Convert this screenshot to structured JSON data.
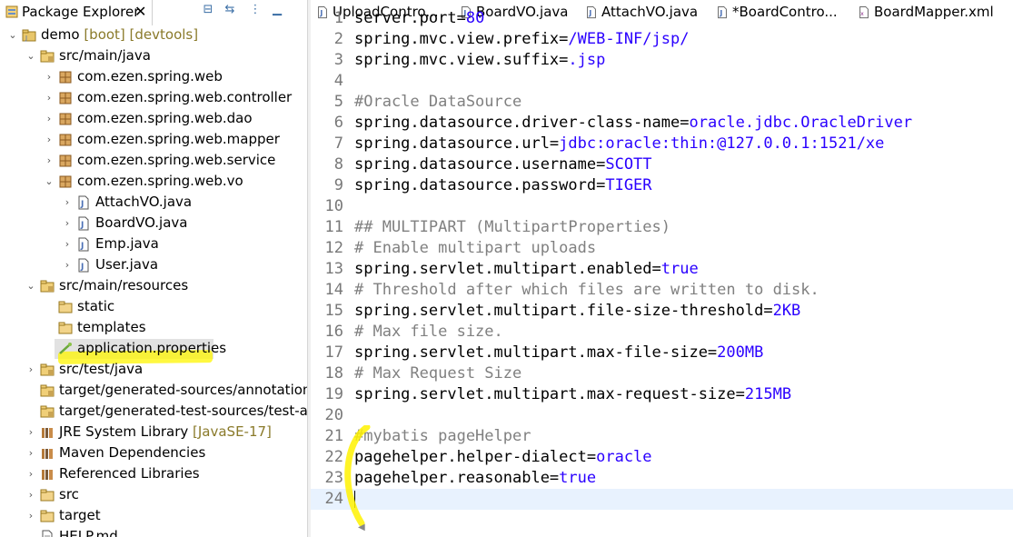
{
  "explorer": {
    "title": "Package Explorer",
    "close": "✕",
    "toolbar_icons": [
      "collapse-all-icon",
      "link-with-editor-icon",
      "view-menu-icon",
      "minimize-icon"
    ],
    "items": [
      {
        "label": "demo",
        "suffix": " [boot] [devtools]",
        "icon": "project-icon",
        "arrow": "⌄"
      },
      {
        "label": "src/main/java",
        "suffix": "",
        "icon": "source-folder-icon",
        "arrow": "⌄"
      },
      {
        "label": "com.ezen.spring.web",
        "suffix": "",
        "icon": "package-icon",
        "arrow": "›"
      },
      {
        "label": "com.ezen.spring.web.controller",
        "suffix": "",
        "icon": "package-icon",
        "arrow": "›"
      },
      {
        "label": "com.ezen.spring.web.dao",
        "suffix": "",
        "icon": "package-icon",
        "arrow": "›"
      },
      {
        "label": "com.ezen.spring.web.mapper",
        "suffix": "",
        "icon": "package-icon",
        "arrow": "›"
      },
      {
        "label": "com.ezen.spring.web.service",
        "suffix": "",
        "icon": "package-icon",
        "arrow": "›"
      },
      {
        "label": "com.ezen.spring.web.vo",
        "suffix": "",
        "icon": "package-icon",
        "arrow": "⌄"
      },
      {
        "label": "AttachVO.java",
        "suffix": "",
        "icon": "java-file-icon",
        "arrow": "›"
      },
      {
        "label": "BoardVO.java",
        "suffix": "",
        "icon": "java-file-icon",
        "arrow": "›"
      },
      {
        "label": "Emp.java",
        "suffix": "",
        "icon": "java-file-icon",
        "arrow": "›"
      },
      {
        "label": "User.java",
        "suffix": "",
        "icon": "java-file-icon",
        "arrow": "›"
      },
      {
        "label": "src/main/resources",
        "suffix": "",
        "icon": "source-folder-icon",
        "arrow": "⌄"
      },
      {
        "label": "static",
        "suffix": "",
        "icon": "folder-icon",
        "arrow": ""
      },
      {
        "label": "templates",
        "suffix": "",
        "icon": "folder-icon",
        "arrow": ""
      },
      {
        "label": "application.properties",
        "suffix": "",
        "icon": "properties-file-icon",
        "arrow": ""
      },
      {
        "label": "src/test/java",
        "suffix": "",
        "icon": "source-folder-icon",
        "arrow": "›"
      },
      {
        "label": "target/generated-sources/annotations",
        "suffix": "",
        "icon": "source-folder-icon",
        "arrow": ""
      },
      {
        "label": "target/generated-test-sources/test-annotations",
        "suffix": "",
        "icon": "source-folder-icon",
        "arrow": ""
      },
      {
        "label": "JRE System Library",
        "suffix": " [JavaSE-17]",
        "icon": "library-icon",
        "arrow": "›"
      },
      {
        "label": "Maven Dependencies",
        "suffix": "",
        "icon": "library-icon",
        "arrow": "›"
      },
      {
        "label": "Referenced Libraries",
        "suffix": "",
        "icon": "library-icon",
        "arrow": "›"
      },
      {
        "label": "src",
        "suffix": "",
        "icon": "folder-icon",
        "arrow": "›"
      },
      {
        "label": "target",
        "suffix": "",
        "icon": "folder-icon",
        "arrow": "›"
      },
      {
        "label": "HELP.md",
        "suffix": "",
        "icon": "text-file-icon",
        "arrow": ""
      }
    ]
  },
  "editor": {
    "tabs": [
      {
        "label": "UploadContro...",
        "icon": "java-file-icon"
      },
      {
        "label": "BoardVO.java",
        "icon": "java-file-icon"
      },
      {
        "label": "AttachVO.java",
        "icon": "java-file-icon"
      },
      {
        "label": "*BoardContro...",
        "icon": "java-file-icon"
      },
      {
        "label": "BoardMapper.xml",
        "icon": "xml-file-icon"
      }
    ],
    "lines": [
      {
        "n": "1",
        "key": "server.port=",
        "value": "80",
        "comment": ""
      },
      {
        "n": "2",
        "key": "spring.mvc.view.prefix=",
        "value": "/WEB-INF/jsp/",
        "comment": ""
      },
      {
        "n": "3",
        "key": "spring.mvc.view.suffix=",
        "value": ".jsp",
        "comment": ""
      },
      {
        "n": "4",
        "key": "",
        "value": "",
        "comment": ""
      },
      {
        "n": "5",
        "key": "",
        "value": "",
        "comment": "#Oracle DataSource"
      },
      {
        "n": "6",
        "key": "spring.datasource.driver-class-name=",
        "value": "oracle.jdbc.OracleDriver",
        "comment": ""
      },
      {
        "n": "7",
        "key": "spring.datasource.url=",
        "value": "jdbc:oracle:thin:@127.0.0.1:1521/xe",
        "comment": ""
      },
      {
        "n": "8",
        "key": "spring.datasource.username=",
        "value": "SCOTT",
        "comment": ""
      },
      {
        "n": "9",
        "key": "spring.datasource.password=",
        "value": "TIGER",
        "comment": ""
      },
      {
        "n": "10",
        "key": "",
        "value": "",
        "comment": ""
      },
      {
        "n": "11",
        "key": "",
        "value": "",
        "comment": "## MULTIPART (MultipartProperties)"
      },
      {
        "n": "12",
        "key": "",
        "value": "",
        "comment": "# Enable multipart uploads"
      },
      {
        "n": "13",
        "key": "spring.servlet.multipart.enabled=",
        "value": "true",
        "comment": ""
      },
      {
        "n": "14",
        "key": "",
        "value": "",
        "comment": "# Threshold after which files are written to disk."
      },
      {
        "n": "15",
        "key": "spring.servlet.multipart.file-size-threshold=",
        "value": "2KB",
        "comment": ""
      },
      {
        "n": "16",
        "key": "",
        "value": "",
        "comment": "# Max file size."
      },
      {
        "n": "17",
        "key": "spring.servlet.multipart.max-file-size=",
        "value": "200MB",
        "comment": ""
      },
      {
        "n": "18",
        "key": "",
        "value": "",
        "comment": "# Max Request Size"
      },
      {
        "n": "19",
        "key": "spring.servlet.multipart.max-request-size=",
        "value": "215MB",
        "comment": ""
      },
      {
        "n": "20",
        "key": "",
        "value": "",
        "comment": ""
      },
      {
        "n": "21",
        "key": "",
        "value": "",
        "comment": "#mybatis pageHelper"
      },
      {
        "n": "22",
        "key": "pagehelper.helper-dialect=",
        "value": "oracle",
        "comment": ""
      },
      {
        "n": "23",
        "key": "pagehelper.reasonable=",
        "value": "true",
        "comment": ""
      },
      {
        "n": "24",
        "key": "",
        "value": "",
        "comment": ""
      }
    ],
    "current_line": "24"
  },
  "colors": {
    "value": "#2a00ff",
    "comment": "#808080",
    "current_line_bg": "#e8f2fe",
    "highlighter": "#fff500"
  }
}
